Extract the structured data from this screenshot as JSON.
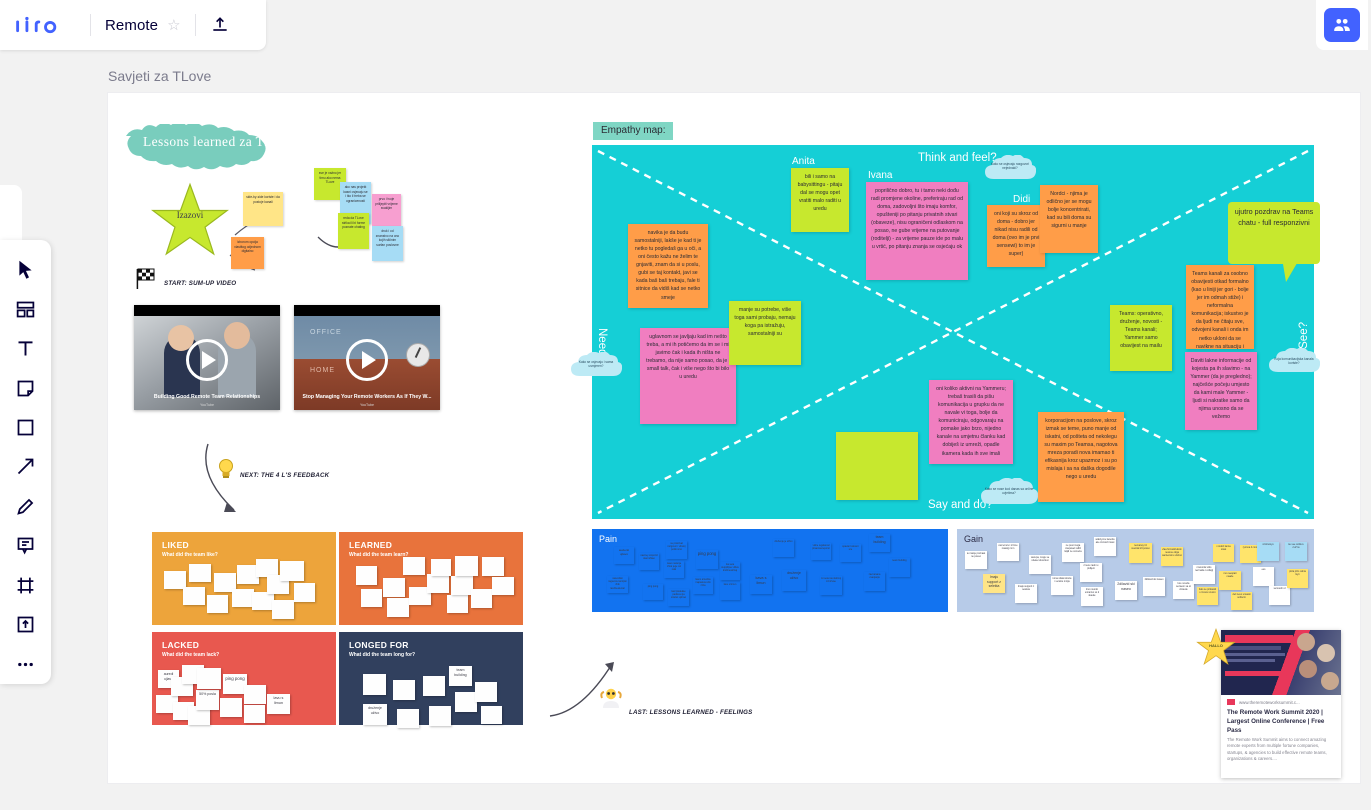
{
  "app": {
    "name": "miro",
    "board_title": "Remote",
    "favorite_icon": "star-icon",
    "export_icon": "upload-icon",
    "share_icon": "people-icon",
    "canvas_label": "Savjeti za TLove"
  },
  "toolbar": {
    "items": [
      {
        "name": "cursor-tool",
        "icon": "cursor-icon"
      },
      {
        "name": "templates-tool",
        "icon": "templates-icon"
      },
      {
        "name": "text-tool",
        "icon": "text-icon"
      },
      {
        "name": "sticky-tool",
        "icon": "sticky-note-icon"
      },
      {
        "name": "shape-tool",
        "icon": "square-icon"
      },
      {
        "name": "arrow-tool",
        "icon": "arrow-icon"
      },
      {
        "name": "pen-tool",
        "icon": "pen-icon"
      },
      {
        "name": "comment-tool",
        "icon": "comment-icon"
      },
      {
        "name": "frame-tool",
        "icon": "frame-icon"
      },
      {
        "name": "upload-tool",
        "icon": "upload-box-icon"
      },
      {
        "name": "more-tool",
        "icon": "ellipsis-icon"
      }
    ]
  },
  "board": {
    "title_banner": "Lessons learned za TLove",
    "star_label": "Izazovi",
    "flag_label": "START: SUM-UP VIDEO",
    "next_label": "NEXT: THE 4 L'S FEEDBACK",
    "last_label": "LAST: LESSONS LEARNED - FEELINGS",
    "videos": [
      {
        "caption": "Building Good Remote Team Relationships",
        "source": "YouTube"
      },
      {
        "caption": "Stop Managing Your Remote Workers As If They W...",
        "source": "YouTube"
      }
    ],
    "idea_notes": [
      {
        "text": "side-by-side koriste i da postoje kanali",
        "color": "#ffe587"
      },
      {
        "text": "izborom opcija vlastitog odjednom digitalno",
        "color": "#ff9d48"
      },
      {
        "text": "sve je važno jer timu ako nema TLove",
        "color": "#c7e82e"
      },
      {
        "text": "ako nas projekt kasni osjecaju se i tko il treba se ogranicenosti",
        "color": "#a6dcf5"
      },
      {
        "text": "prvo i tvoje prilijepiti vrijeme svakijim",
        "color": "#f79fd0"
      },
      {
        "text": "reda da TLove strika ili bi forme poznate chating",
        "color": "#c7e82e"
      },
      {
        "text": "druk i od znanstvo na ono kojih sličnim surfan poslovne",
        "color": "#a6dcf5"
      }
    ],
    "quadrants": [
      {
        "title": "LIKED",
        "subtitle": "What did the team like?",
        "color": "#eda43b",
        "notes": 13
      },
      {
        "title": "LEARNED",
        "subtitle": "What did the team learn?",
        "color": "#e8733c",
        "notes": 14
      },
      {
        "title": "LACKED",
        "subtitle": "What did the team lack?",
        "color": "#e8584f",
        "notes": 14
      },
      {
        "title": "LONGED FOR",
        "subtitle": "What did the team long for?",
        "color": "#31405e",
        "notes": 10
      }
    ]
  },
  "empathy": {
    "tag": "Empathy map:",
    "bg_color": "#15cfd6",
    "quadrant_labels": {
      "think_feel": "Think and feel?",
      "need": "Need?",
      "see": "See?",
      "say_do": "Say and do?"
    },
    "people": [
      "Anita",
      "Ivana",
      "Didi"
    ],
    "clouds": [
      {
        "text": "Kako se osjecaju razgovori nejednaki?"
      },
      {
        "text": "Kako se osjecaju i sama usmjeren?"
      },
      {
        "text": "Koja komunikacijska kanala koriste?"
      },
      {
        "text": "Kako se nose kod danas sa online uvjetima?"
      }
    ],
    "stickies": [
      {
        "color": "#c7e82e",
        "text": "bili i samo na babysittingu - pitaju dal se mogu opet vratiti malo raditi u uredu"
      },
      {
        "color": "#f07ec0",
        "text": "poprilično dobro, tu i tamo neki dođu radi promjene okoline, preferiraju rad od doma, zadovoljni što imaju komfor, opušteniji po pitanju privatnih stvari (obaveze), nisu ograničeni odlaskom na posao, ne gube vrijeme na putovanje (roditelji) - za vrijeme pauze ide po malu u vrtić, po pitanju znanja se osjećaju ok"
      },
      {
        "color": "#ff9d48",
        "text": "navika je da budu samostalniji, lakše je kad ti je netko tu pogledaš ga u oči, a oni često kažu ne želim te gnjaviti, znam da si u poslu, gubi se taj kontakt, javi se kada baš baš trebaju, fale ti sitnice da vidiš kad se netko smeje"
      },
      {
        "color": "#f07ec0",
        "text": "uglavnom se javljaju kad im nešto treba, a mi ih potičemo da im se i mi javimo čak i kada ih ništa ne trebamo, da nije samo posao, da je i small talk, čak i više nego što bi bilo u uredu"
      },
      {
        "color": "#c7e82e",
        "text": "manje su potrebe, više toga sami probaju, nemaju koga pa istražuju, samostalniji su"
      },
      {
        "color": "#ff9d48",
        "text": "oni koji su skroz od doma - dobro jer nikad nisu radili od doma (ovo im je prvi sensewi) to im je super)"
      },
      {
        "color": "#ff9d48",
        "text": "Nordci - njima je odlično jer se mogu bolje koncentrirati, kad su bili doma su sigurni u manje"
      },
      {
        "color": "#c7e82e",
        "text": "Teams: operativno, druženje, novosti - Teams kanali; Yammer samo obavijest na mailu"
      },
      {
        "color": "#ff9d48",
        "text": "Teams kanali za osobno obavijesti otkad formalno (kao u liniji jer gori - bolje jer im odmah stiže) i neformalna komunikacija; iskustvo je da ljudi ne čitaju sve, odvojeni kanali i onda im netko ukloni da se navikne na situaciju i nekome više informacija vidjeti se prosvećeni"
      },
      {
        "color": "#f07ec0",
        "text": "oni koliko aktivni na Yammeru; trebaš trasili da pišu komunikacija u grupku da ne navale vi toga, bolje da komuniciraju, odgovaraju na pomake jako brzo, nijedno kanale na umjetnu članku kad dobiješ iz umreži, opadle ikamera kada ih sve imali"
      },
      {
        "color": "#ff9d48",
        "text": "korporacijom na poslove, skroz izmak se teme, puno manje od iskatni, od pošteta od nekolegu su maxim po Teamsa, nagotova mreza poradi nova imamao ti efikasnija kroz upazmoz i su po mislaja i sa na daška dogodile nego u uredu"
      },
      {
        "color": "#f07ec0",
        "text": "Daviti lakne informacije od kojesta pa ih slavimo - na Yammer (da je pregledno); najčešće počeju umjesto da kami male Yammer - ljudi si nakratke samo da njima unosno da se vežemo"
      }
    ],
    "bubble_text": "ujutro pozdrav na Teams chatu - full responzivni"
  },
  "pain": {
    "title": "Pain",
    "bg_color": "#1273f0",
    "notes": [
      "audenti ujlavo",
      "navicey srsporid skat ishtao",
      "nasveliksi raguvore tamipisi zbik rasztšesleniar",
      "ping pong",
      "ne prostrval razgovor i vrlistoj pošlo smo",
      "naso rastanje chrat jege ovi naki",
      "kad piodekse padisca nja strariet uphow",
      "lasco arredina mapastva szlo zzza",
      "lva seta stupplitjue vlibav krolbnestrinaj",
      "lavu s limun",
      "druženje je uživo",
      "vishe regularval piisamsa teporst",
      "mi seta ras slahnoj zd iizvise",
      "spavanl ostvat i ure",
      "zavnanana ovanjanja",
      "team building",
      "nardi poticoca a i čarolize",
      "nosul ishobicya i vospiso"
    ]
  },
  "gain": {
    "title": "Gain",
    "bg_color": "#b7cbe8",
    "notes": [
      "te manje poznaat ne poveo",
      "cad ernov i izznce maarig mnn",
      "Imaju support z selekta",
      "vanupa, mogu se ndeke tolosztuvi",
      "roma sfatat dosrie i verslou mnija",
      "ne pust moga zaupaveli odlili laljdi ne comeza",
      "rmuou radni u pidljeni",
      "lmo nourdo unranivo so it slaude",
      "wakriyvne laoenla ale ommozi imasi",
      "nemanuy tiz svetcial 24 posso",
      "2dilavid ski naseo",
      "vlaa formalizuksim nesone odga samienionu ulvitno",
      "lore nouvla sezsenn sa ot cizaude",
      "msoorda viišo nermaba t colšqji",
      "balo se pridaskti s rmoos vruozo",
      "v iodori lanna otoat",
      "mo ceespati naade",
      "deli nevo uroaski soblerni",
      "ryonna 4 conw",
      "eus",
      "semoodn d",
      "vznlcutoyu",
      "ke vee onbiu'e cviz'ns",
      "picla ptirs odnia loyn",
      "ney ligrabl opilyni ztoid neod",
      "uznie sabolu osennen",
      "dbunle remoora a renmaerng venji"
    ]
  },
  "link_card": {
    "url": "www.theremoteworksummit.c...",
    "title": "The Remote Work Summit 2020 | Largest Online Conference | Free Pass",
    "description": "The Remote Work Summit aims to connect amazing remote experts from multiple fortune companies, startups, & agencies to build effective remote teams, organizations & careers....",
    "badge": "HALLO"
  }
}
